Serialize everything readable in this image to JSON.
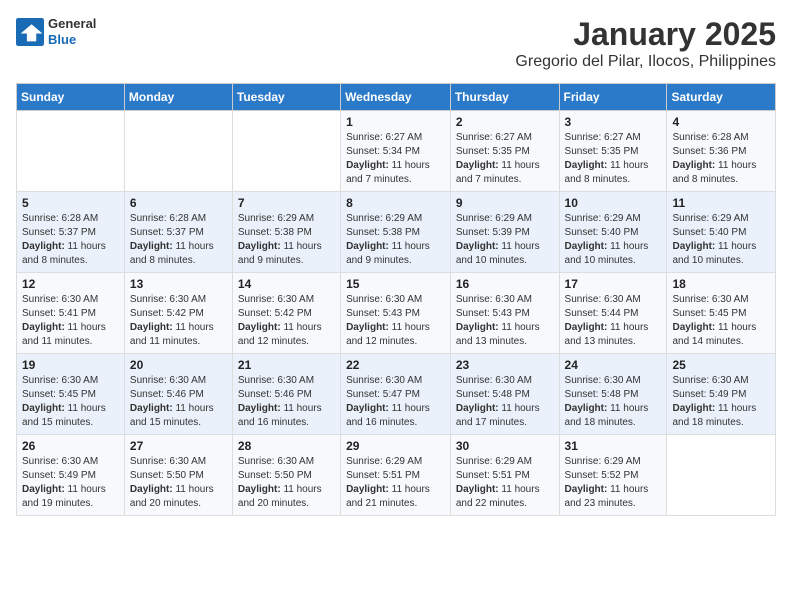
{
  "header": {
    "logo": {
      "general": "General",
      "blue": "Blue"
    },
    "title": "January 2025",
    "subtitle": "Gregorio del Pilar, Ilocos, Philippines"
  },
  "calendar": {
    "days_of_week": [
      "Sunday",
      "Monday",
      "Tuesday",
      "Wednesday",
      "Thursday",
      "Friday",
      "Saturday"
    ],
    "weeks": [
      [
        {
          "day": "",
          "info": ""
        },
        {
          "day": "",
          "info": ""
        },
        {
          "day": "",
          "info": ""
        },
        {
          "day": "1",
          "info": "Sunrise: 6:27 AM\nSunset: 5:34 PM\nDaylight: 11 hours and 7 minutes."
        },
        {
          "day": "2",
          "info": "Sunrise: 6:27 AM\nSunset: 5:35 PM\nDaylight: 11 hours and 7 minutes."
        },
        {
          "day": "3",
          "info": "Sunrise: 6:27 AM\nSunset: 5:35 PM\nDaylight: 11 hours and 8 minutes."
        },
        {
          "day": "4",
          "info": "Sunrise: 6:28 AM\nSunset: 5:36 PM\nDaylight: 11 hours and 8 minutes."
        }
      ],
      [
        {
          "day": "5",
          "info": "Sunrise: 6:28 AM\nSunset: 5:37 PM\nDaylight: 11 hours and 8 minutes."
        },
        {
          "day": "6",
          "info": "Sunrise: 6:28 AM\nSunset: 5:37 PM\nDaylight: 11 hours and 8 minutes."
        },
        {
          "day": "7",
          "info": "Sunrise: 6:29 AM\nSunset: 5:38 PM\nDaylight: 11 hours and 9 minutes."
        },
        {
          "day": "8",
          "info": "Sunrise: 6:29 AM\nSunset: 5:38 PM\nDaylight: 11 hours and 9 minutes."
        },
        {
          "day": "9",
          "info": "Sunrise: 6:29 AM\nSunset: 5:39 PM\nDaylight: 11 hours and 10 minutes."
        },
        {
          "day": "10",
          "info": "Sunrise: 6:29 AM\nSunset: 5:40 PM\nDaylight: 11 hours and 10 minutes."
        },
        {
          "day": "11",
          "info": "Sunrise: 6:29 AM\nSunset: 5:40 PM\nDaylight: 11 hours and 10 minutes."
        }
      ],
      [
        {
          "day": "12",
          "info": "Sunrise: 6:30 AM\nSunset: 5:41 PM\nDaylight: 11 hours and 11 minutes."
        },
        {
          "day": "13",
          "info": "Sunrise: 6:30 AM\nSunset: 5:42 PM\nDaylight: 11 hours and 11 minutes."
        },
        {
          "day": "14",
          "info": "Sunrise: 6:30 AM\nSunset: 5:42 PM\nDaylight: 11 hours and 12 minutes."
        },
        {
          "day": "15",
          "info": "Sunrise: 6:30 AM\nSunset: 5:43 PM\nDaylight: 11 hours and 12 minutes."
        },
        {
          "day": "16",
          "info": "Sunrise: 6:30 AM\nSunset: 5:43 PM\nDaylight: 11 hours and 13 minutes."
        },
        {
          "day": "17",
          "info": "Sunrise: 6:30 AM\nSunset: 5:44 PM\nDaylight: 11 hours and 13 minutes."
        },
        {
          "day": "18",
          "info": "Sunrise: 6:30 AM\nSunset: 5:45 PM\nDaylight: 11 hours and 14 minutes."
        }
      ],
      [
        {
          "day": "19",
          "info": "Sunrise: 6:30 AM\nSunset: 5:45 PM\nDaylight: 11 hours and 15 minutes."
        },
        {
          "day": "20",
          "info": "Sunrise: 6:30 AM\nSunset: 5:46 PM\nDaylight: 11 hours and 15 minutes."
        },
        {
          "day": "21",
          "info": "Sunrise: 6:30 AM\nSunset: 5:46 PM\nDaylight: 11 hours and 16 minutes."
        },
        {
          "day": "22",
          "info": "Sunrise: 6:30 AM\nSunset: 5:47 PM\nDaylight: 11 hours and 16 minutes."
        },
        {
          "day": "23",
          "info": "Sunrise: 6:30 AM\nSunset: 5:48 PM\nDaylight: 11 hours and 17 minutes."
        },
        {
          "day": "24",
          "info": "Sunrise: 6:30 AM\nSunset: 5:48 PM\nDaylight: 11 hours and 18 minutes."
        },
        {
          "day": "25",
          "info": "Sunrise: 6:30 AM\nSunset: 5:49 PM\nDaylight: 11 hours and 18 minutes."
        }
      ],
      [
        {
          "day": "26",
          "info": "Sunrise: 6:30 AM\nSunset: 5:49 PM\nDaylight: 11 hours and 19 minutes."
        },
        {
          "day": "27",
          "info": "Sunrise: 6:30 AM\nSunset: 5:50 PM\nDaylight: 11 hours and 20 minutes."
        },
        {
          "day": "28",
          "info": "Sunrise: 6:30 AM\nSunset: 5:50 PM\nDaylight: 11 hours and 20 minutes."
        },
        {
          "day": "29",
          "info": "Sunrise: 6:29 AM\nSunset: 5:51 PM\nDaylight: 11 hours and 21 minutes."
        },
        {
          "day": "30",
          "info": "Sunrise: 6:29 AM\nSunset: 5:51 PM\nDaylight: 11 hours and 22 minutes."
        },
        {
          "day": "31",
          "info": "Sunrise: 6:29 AM\nSunset: 5:52 PM\nDaylight: 11 hours and 23 minutes."
        },
        {
          "day": "",
          "info": ""
        }
      ]
    ]
  }
}
